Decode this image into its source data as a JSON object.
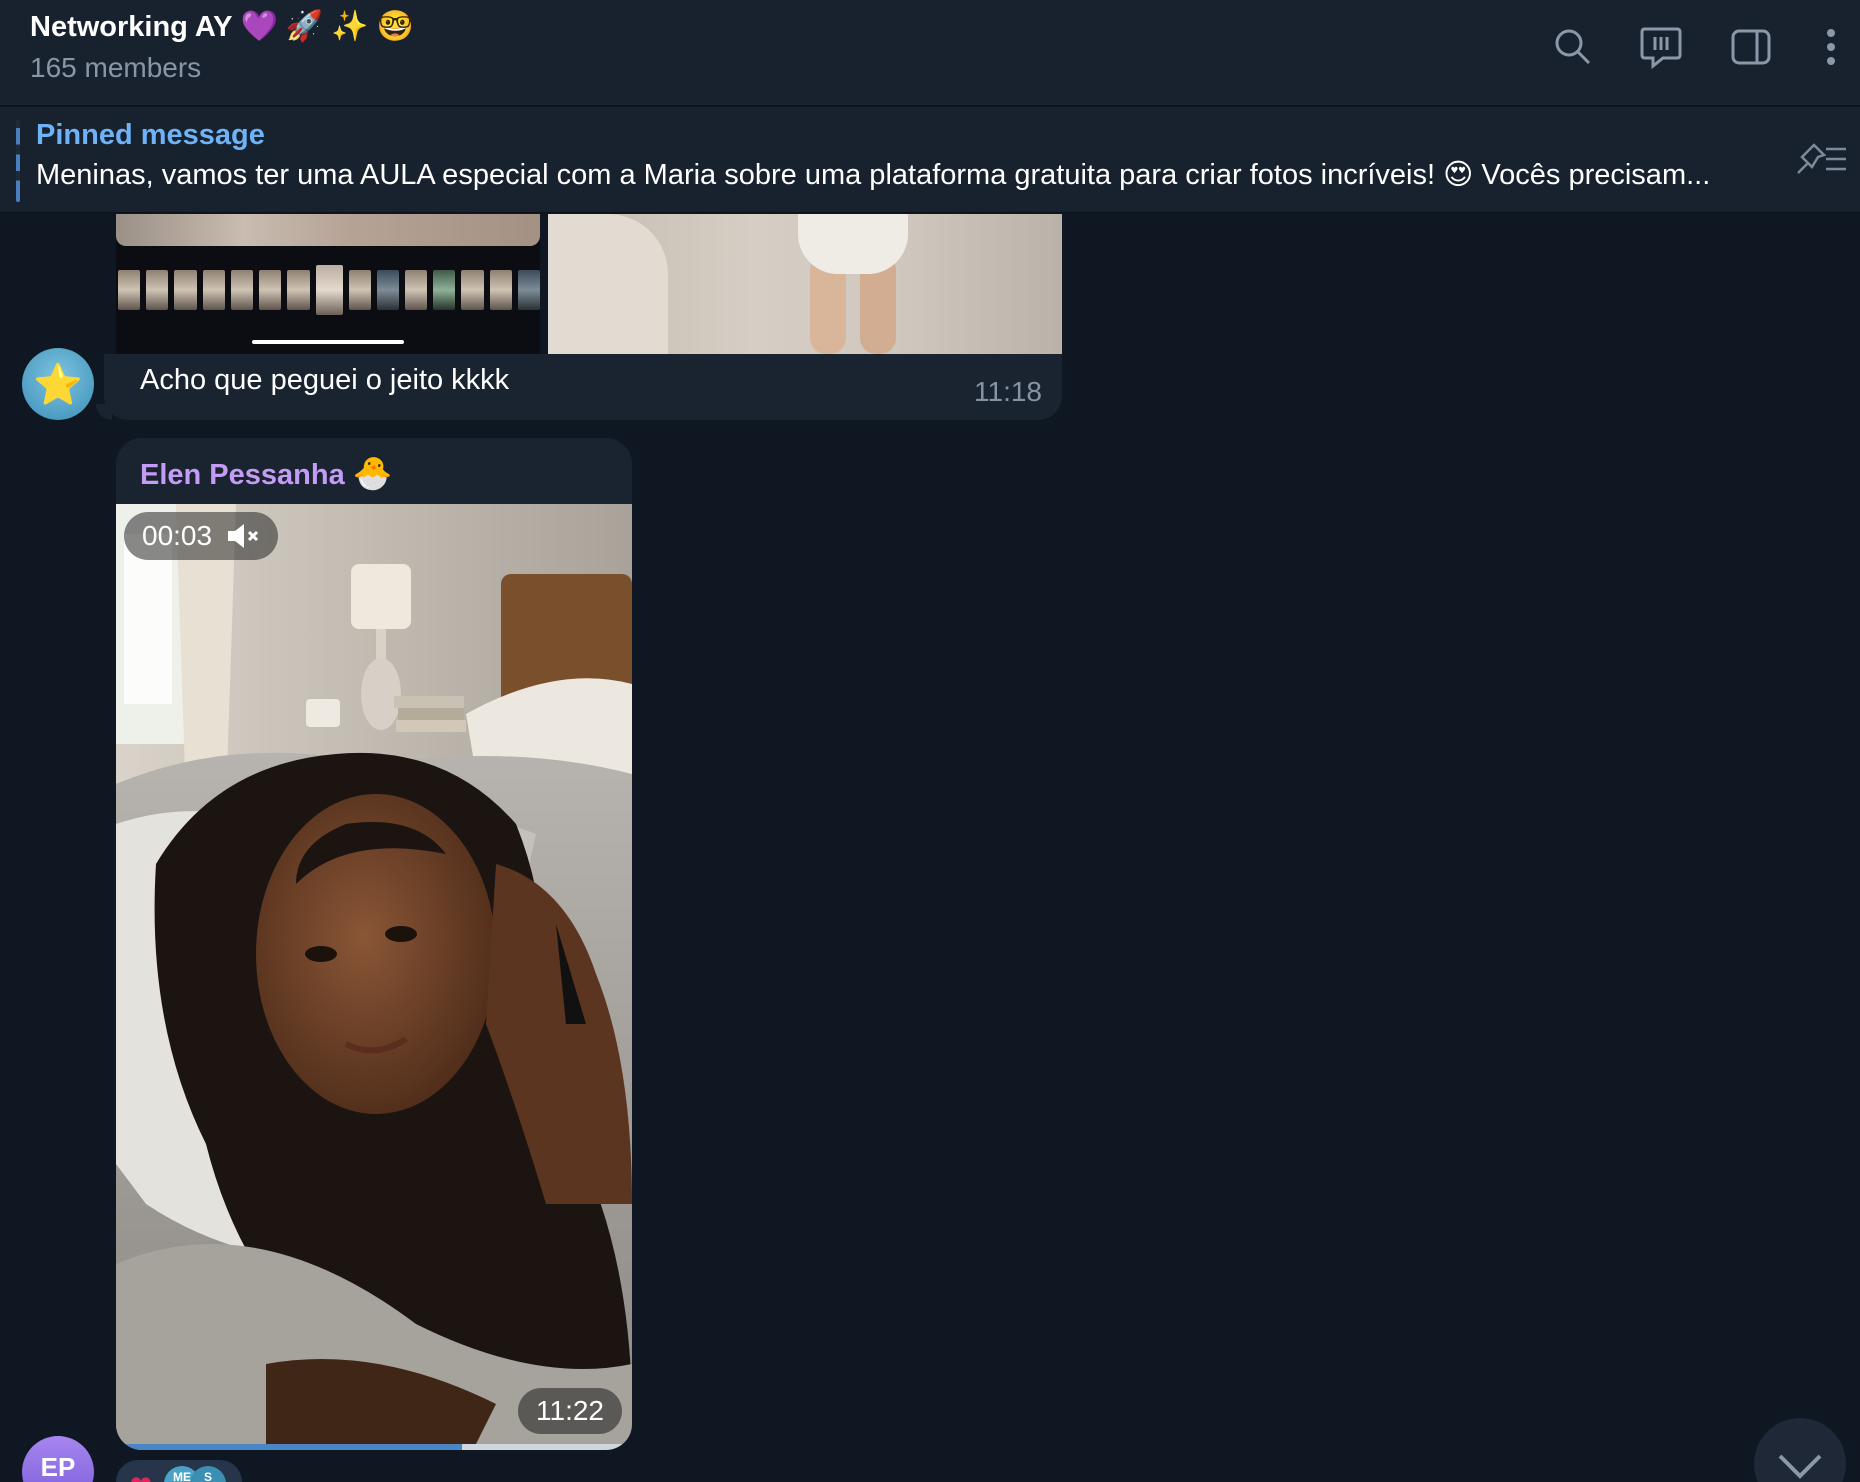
{
  "header": {
    "title": "Networking AY",
    "title_emojis": [
      "💜",
      "🚀",
      "✨",
      "🤓"
    ],
    "member_count": "165 members",
    "icons": [
      "search-icon",
      "topics-icon",
      "sidebar-toggle-icon",
      "more-vertical-icon"
    ]
  },
  "pinned": {
    "title": "Pinned message",
    "text": "Meninas, vamos ter uma AULA especial com a Maria  sobre uma plataforma gratuita para criar fotos incríveis! 😍  Vocês precisam...",
    "icon": "pinned-list-icon"
  },
  "messages": [
    {
      "avatar_icon": "star-face-icon",
      "text": "Acho que peguei o jeito kkkk",
      "time": "11:18"
    },
    {
      "sender": "Elen Pessanha",
      "sender_emoji": "🐣",
      "video_duration": "00:03",
      "video_time": "11:22",
      "muted_icon": "speaker-muted-icon",
      "progress_fraction": 0.67
    }
  ],
  "avatar_ep": "EP",
  "reactions": {
    "emoji": "❤",
    "avatars": [
      "ME",
      "S"
    ]
  },
  "colors": {
    "background": "#0f1722",
    "bubble": "#1a2330",
    "accent_link": "#6eb3f7",
    "sender_name": "#c59cf5"
  }
}
